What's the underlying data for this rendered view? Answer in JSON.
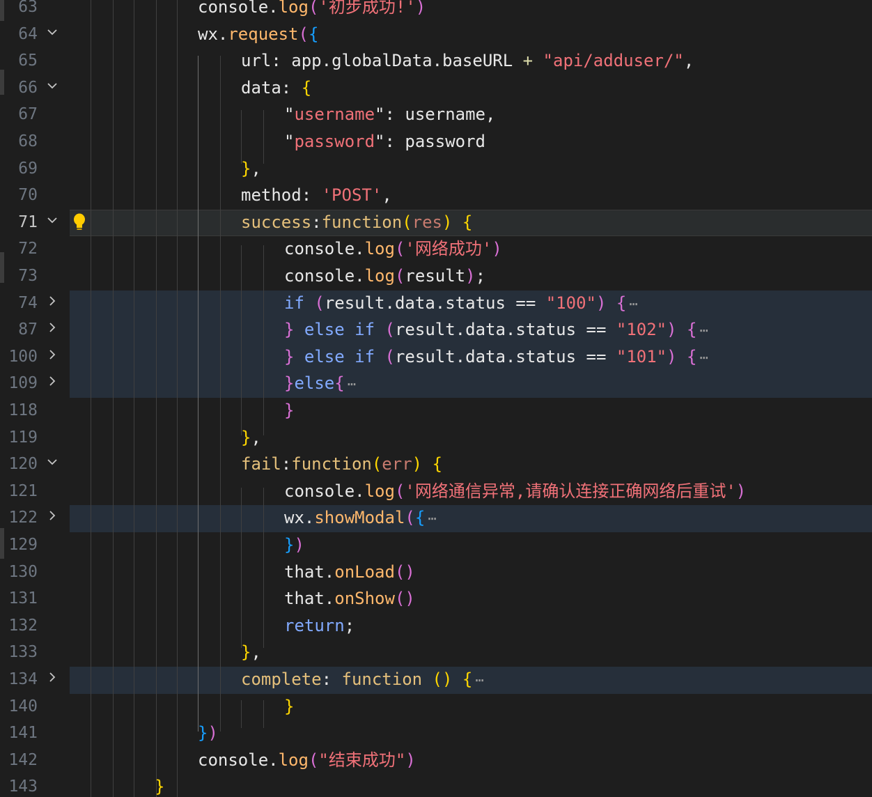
{
  "editor": {
    "lines": [
      {
        "n": "63",
        "fold": "",
        "segs": [
          [
            "console",
            "plain"
          ],
          [
            ".",
            "plain"
          ],
          [
            "log",
            "fn2"
          ],
          [
            "(",
            "b2"
          ],
          [
            "'初步成功!'",
            "str"
          ],
          [
            ")",
            "b2"
          ]
        ]
      },
      {
        "n": "64",
        "fold": "v",
        "segs": [
          [
            "wx",
            "plain"
          ],
          [
            ".",
            "plain"
          ],
          [
            "request",
            "fn2"
          ],
          [
            "(",
            "b2"
          ],
          [
            "{",
            "b3"
          ]
        ]
      },
      {
        "n": "65",
        "fold": "",
        "segs": [
          [
            "url",
            "plain"
          ],
          [
            ": ",
            "plain"
          ],
          [
            "app",
            "plain"
          ],
          [
            ".",
            "plain"
          ],
          [
            "globalData",
            "plain"
          ],
          [
            ".",
            "plain"
          ],
          [
            "baseURL",
            "plain"
          ],
          [
            " + ",
            "op"
          ],
          [
            "\"api/adduser/\"",
            "str"
          ],
          [
            ",",
            "plain"
          ]
        ]
      },
      {
        "n": "66",
        "fold": "v",
        "segs": [
          [
            "data",
            "plain"
          ],
          [
            ": ",
            "plain"
          ],
          [
            "{",
            "b1"
          ]
        ]
      },
      {
        "n": "67",
        "fold": "",
        "segs": [
          [
            "\"",
            "plain"
          ],
          [
            "username",
            "str"
          ],
          [
            "\"",
            "plain"
          ],
          [
            ": ",
            "plain"
          ],
          [
            "username",
            "plain"
          ],
          [
            ",",
            "plain"
          ]
        ]
      },
      {
        "n": "68",
        "fold": "",
        "segs": [
          [
            "\"",
            "plain"
          ],
          [
            "password",
            "str"
          ],
          [
            "\"",
            "plain"
          ],
          [
            ": ",
            "plain"
          ],
          [
            "password",
            "plain"
          ]
        ]
      },
      {
        "n": "69",
        "fold": "",
        "segs": [
          [
            "}",
            "b1"
          ],
          [
            ",",
            "plain"
          ]
        ]
      },
      {
        "n": "70",
        "fold": "",
        "segs": [
          [
            "method",
            "plain"
          ],
          [
            ": ",
            "plain"
          ],
          [
            "'POST'",
            "str"
          ],
          [
            ",",
            "plain"
          ]
        ]
      },
      {
        "n": "71",
        "fold": "v",
        "segs": [
          [
            "success",
            "prop"
          ],
          [
            ":",
            "plain"
          ],
          [
            "function",
            "prop"
          ],
          [
            "(",
            "b1"
          ],
          [
            "res",
            "param"
          ],
          [
            ")",
            "b1"
          ],
          [
            " ",
            "plain"
          ],
          [
            "{",
            "b1"
          ]
        ]
      },
      {
        "n": "72",
        "fold": "",
        "segs": [
          [
            "console",
            "plain"
          ],
          [
            ".",
            "plain"
          ],
          [
            "log",
            "fn2"
          ],
          [
            "(",
            "b2"
          ],
          [
            "'网络成功'",
            "str"
          ],
          [
            ")",
            "b2"
          ]
        ]
      },
      {
        "n": "73",
        "fold": "",
        "segs": [
          [
            "console",
            "plain"
          ],
          [
            ".",
            "plain"
          ],
          [
            "log",
            "fn2"
          ],
          [
            "(",
            "b2"
          ],
          [
            "result",
            "plain"
          ],
          [
            ")",
            "b2"
          ],
          [
            ";",
            "plain"
          ]
        ]
      },
      {
        "n": "74",
        "fold": ">",
        "segs": [
          [
            "if",
            "kw"
          ],
          [
            " ",
            "plain"
          ],
          [
            "(",
            "b2"
          ],
          [
            "result",
            "plain"
          ],
          [
            ".",
            "plain"
          ],
          [
            "data",
            "plain"
          ],
          [
            ".",
            "plain"
          ],
          [
            "status",
            "plain"
          ],
          [
            " == ",
            "plain"
          ],
          [
            "\"100\"",
            "str"
          ],
          [
            ")",
            "b2"
          ],
          [
            " ",
            "plain"
          ],
          [
            "{",
            "b2"
          ]
        ],
        "ell": true
      },
      {
        "n": "87",
        "fold": ">",
        "segs": [
          [
            "}",
            "b2"
          ],
          [
            " ",
            "plain"
          ],
          [
            "else",
            "kw"
          ],
          [
            " ",
            "plain"
          ],
          [
            "if",
            "kw"
          ],
          [
            " ",
            "plain"
          ],
          [
            "(",
            "b2"
          ],
          [
            "result",
            "plain"
          ],
          [
            ".",
            "plain"
          ],
          [
            "data",
            "plain"
          ],
          [
            ".",
            "plain"
          ],
          [
            "status",
            "plain"
          ],
          [
            " == ",
            "plain"
          ],
          [
            "\"102\"",
            "str"
          ],
          [
            ")",
            "b2"
          ],
          [
            " ",
            "plain"
          ],
          [
            "{",
            "b2"
          ]
        ],
        "ell": true
      },
      {
        "n": "100",
        "fold": ">",
        "segs": [
          [
            "}",
            "b2"
          ],
          [
            " ",
            "plain"
          ],
          [
            "else",
            "kw"
          ],
          [
            " ",
            "plain"
          ],
          [
            "if",
            "kw"
          ],
          [
            " ",
            "plain"
          ],
          [
            "(",
            "b2"
          ],
          [
            "result",
            "plain"
          ],
          [
            ".",
            "plain"
          ],
          [
            "data",
            "plain"
          ],
          [
            ".",
            "plain"
          ],
          [
            "status",
            "plain"
          ],
          [
            " == ",
            "plain"
          ],
          [
            "\"101\"",
            "str"
          ],
          [
            ")",
            "b2"
          ],
          [
            " ",
            "plain"
          ],
          [
            "{",
            "b2"
          ]
        ],
        "ell": true
      },
      {
        "n": "109",
        "fold": ">",
        "segs": [
          [
            "}",
            "b2"
          ],
          [
            "else",
            "kw"
          ],
          [
            "{",
            "b2"
          ]
        ],
        "ell": true
      },
      {
        "n": "118",
        "fold": "",
        "segs": [
          [
            "}",
            "b2"
          ]
        ]
      },
      {
        "n": "119",
        "fold": "",
        "segs": [
          [
            "}",
            "b1"
          ],
          [
            ",",
            "plain"
          ]
        ]
      },
      {
        "n": "120",
        "fold": "v",
        "segs": [
          [
            "fail",
            "prop"
          ],
          [
            ":",
            "plain"
          ],
          [
            "function",
            "prop"
          ],
          [
            "(",
            "b1"
          ],
          [
            "err",
            "param"
          ],
          [
            ")",
            "b1"
          ],
          [
            " ",
            "plain"
          ],
          [
            "{",
            "b1"
          ]
        ]
      },
      {
        "n": "121",
        "fold": "",
        "segs": [
          [
            "console",
            "plain"
          ],
          [
            ".",
            "plain"
          ],
          [
            "log",
            "fn2"
          ],
          [
            "(",
            "b2"
          ],
          [
            "'网络通信异常,请确认连接正确网络后重试'",
            "str"
          ],
          [
            ")",
            "b2"
          ]
        ]
      },
      {
        "n": "122",
        "fold": ">",
        "segs": [
          [
            "wx",
            "plain"
          ],
          [
            ".",
            "plain"
          ],
          [
            "showModal",
            "fn2"
          ],
          [
            "(",
            "b2"
          ],
          [
            "{",
            "b3"
          ]
        ],
        "ell": true
      },
      {
        "n": "129",
        "fold": "",
        "segs": [
          [
            "}",
            "b3"
          ],
          [
            ")",
            "b2"
          ]
        ]
      },
      {
        "n": "130",
        "fold": "",
        "segs": [
          [
            "that",
            "plain"
          ],
          [
            ".",
            "plain"
          ],
          [
            "onLoad",
            "fn2"
          ],
          [
            "()",
            "b2"
          ]
        ]
      },
      {
        "n": "131",
        "fold": "",
        "segs": [
          [
            "that",
            "plain"
          ],
          [
            ".",
            "plain"
          ],
          [
            "onShow",
            "fn2"
          ],
          [
            "()",
            "b2"
          ]
        ]
      },
      {
        "n": "132",
        "fold": "",
        "segs": [
          [
            "return",
            "kw"
          ],
          [
            ";",
            "plain"
          ]
        ]
      },
      {
        "n": "133",
        "fold": "",
        "segs": [
          [
            "}",
            "b1"
          ],
          [
            ",",
            "plain"
          ]
        ]
      },
      {
        "n": "134",
        "fold": ">",
        "segs": [
          [
            "complete",
            "prop"
          ],
          [
            ": ",
            "plain"
          ],
          [
            "function",
            "prop"
          ],
          [
            " ",
            "plain"
          ],
          [
            "()",
            "b1"
          ],
          [
            " ",
            "plain"
          ],
          [
            "{",
            "b1"
          ]
        ],
        "ell": true
      },
      {
        "n": "140",
        "fold": "",
        "segs": [
          [
            "}",
            "b1"
          ]
        ]
      },
      {
        "n": "141",
        "fold": "",
        "segs": [
          [
            "}",
            "b3"
          ],
          [
            ")",
            "b2"
          ]
        ]
      },
      {
        "n": "142",
        "fold": "",
        "segs": [
          [
            "console",
            "plain"
          ],
          [
            ".",
            "plain"
          ],
          [
            "log",
            "fn2"
          ],
          [
            "(",
            "b2"
          ],
          [
            "\"结束成功\"",
            "str"
          ],
          [
            ")",
            "b2"
          ]
        ]
      },
      {
        "n": "143",
        "fold": "",
        "segs": [
          [
            "}",
            "b1"
          ]
        ]
      }
    ],
    "ellipsis": "⋯",
    "fold_expanded_icon": "chevron-down-icon",
    "fold_collapsed_icon": "chevron-right-icon",
    "lightbulb_icon": "lightbulb-icon"
  }
}
